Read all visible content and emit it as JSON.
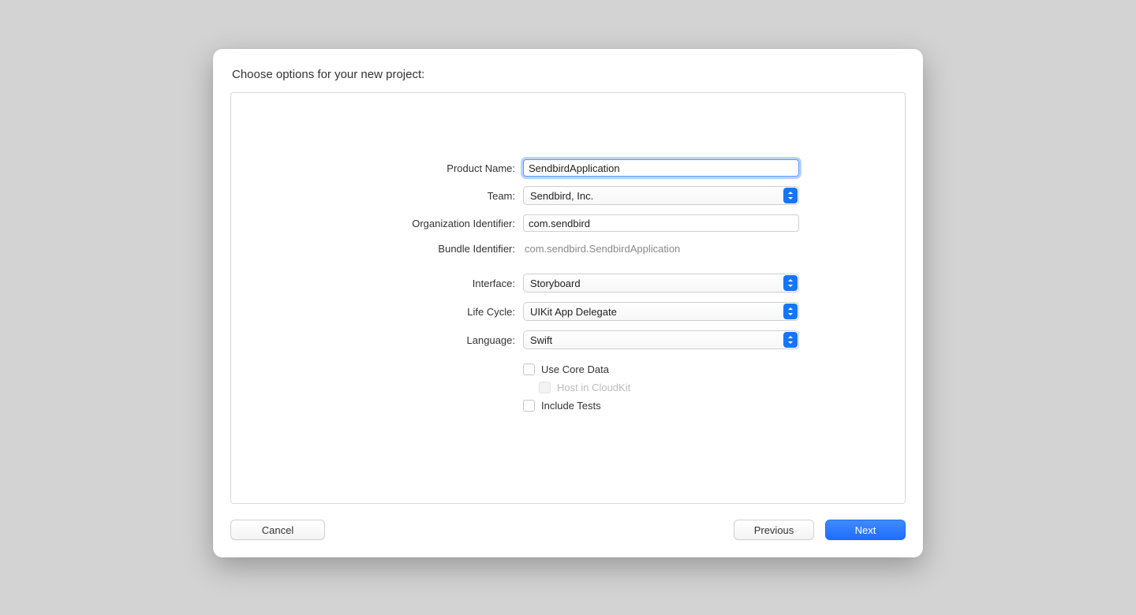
{
  "sheet": {
    "title": "Choose options for your new project:"
  },
  "form": {
    "product_name": {
      "label": "Product Name:",
      "value": "SendbirdApplication"
    },
    "team": {
      "label": "Team:",
      "value": "Sendbird, Inc."
    },
    "org_id": {
      "label": "Organization Identifier:",
      "value": "com.sendbird"
    },
    "bundle_id": {
      "label": "Bundle Identifier:",
      "value": "com.sendbird.SendbirdApplication"
    },
    "interface": {
      "label": "Interface:",
      "value": "Storyboard"
    },
    "life_cycle": {
      "label": "Life Cycle:",
      "value": "UIKit App Delegate"
    },
    "language": {
      "label": "Language:",
      "value": "Swift"
    },
    "use_core_data": {
      "label": "Use Core Data"
    },
    "host_cloudkit": {
      "label": "Host in CloudKit"
    },
    "include_tests": {
      "label": "Include Tests"
    }
  },
  "buttons": {
    "cancel": "Cancel",
    "previous": "Previous",
    "next": "Next"
  }
}
